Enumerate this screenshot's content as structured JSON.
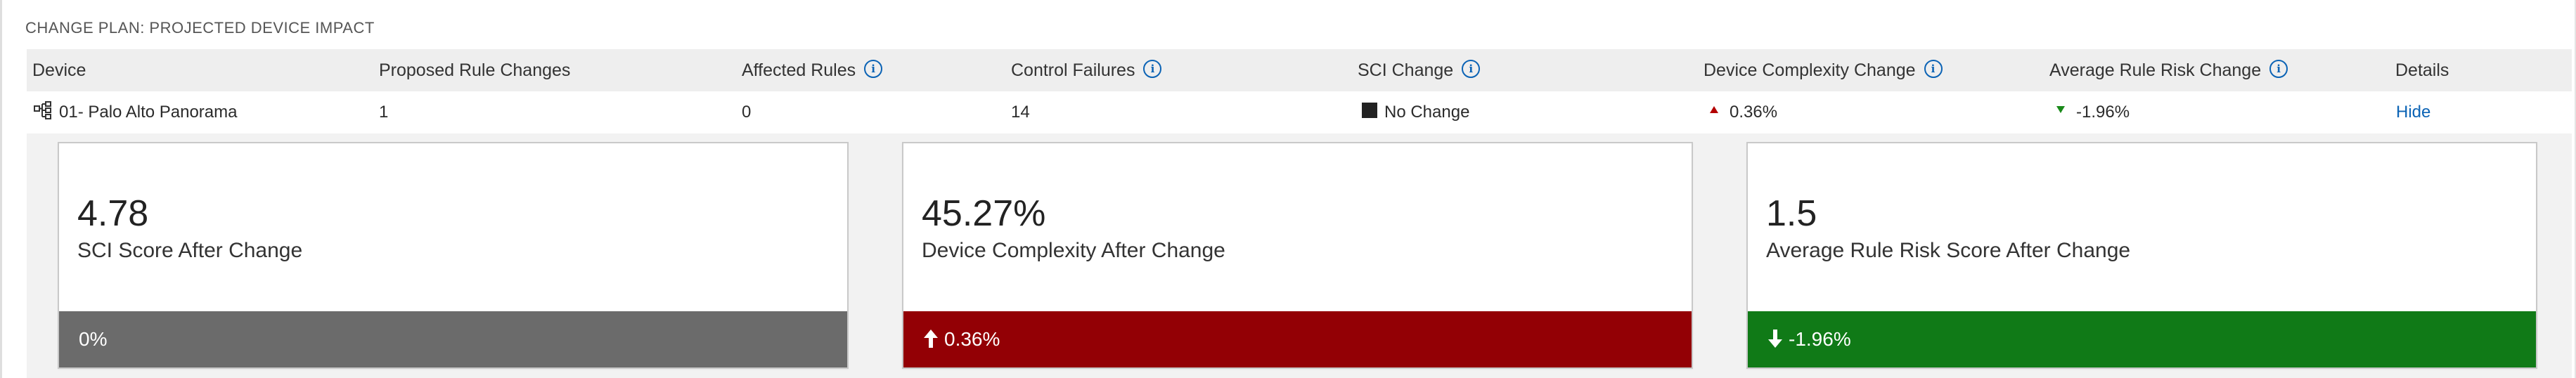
{
  "section": {
    "title": "CHANGE PLAN: PROJECTED DEVICE IMPACT"
  },
  "table": {
    "headers": {
      "device": "Device",
      "proposed_rule_changes": "Proposed Rule Changes",
      "affected_rules": "Affected Rules",
      "control_failures": "Control Failures",
      "sci_change": "SCI Change",
      "device_complexity_change": "Device Complexity Change",
      "average_rule_risk_change": "Average Rule Risk Change",
      "details": "Details"
    },
    "row": {
      "device": "01- Palo Alto Panorama",
      "proposed_rule_changes": "1",
      "affected_rules": "0",
      "control_failures": "14",
      "sci_change": "No Change",
      "device_complexity_change": "0.36%",
      "average_rule_risk_change": "-1.96%",
      "details_link": "Hide"
    }
  },
  "cards": [
    {
      "value": "4.78",
      "label": "SCI Score After Change",
      "footer": "0%",
      "color": "#6b6b6b",
      "trend": "none"
    },
    {
      "value": "45.27%",
      "label": "Device Complexity After Change",
      "footer": "0.36%",
      "color": "#930005",
      "trend": "up"
    },
    {
      "value": "1.5",
      "label": "Average Rule Risk Score After Change",
      "footer": "-1.96%",
      "color": "#107a17",
      "trend": "down"
    }
  ],
  "icons": {
    "device": "device-tree-icon",
    "info": "info-icon",
    "sci_change": "square-icon",
    "increase": "triangle-up-icon",
    "decrease": "triangle-down-icon"
  }
}
